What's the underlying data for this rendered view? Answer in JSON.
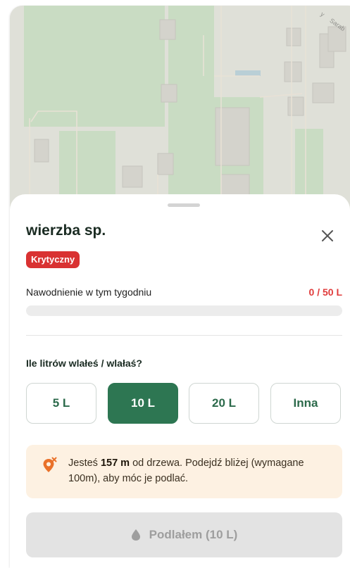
{
  "map": {
    "street_label": "Sarab",
    "street_label_prefix": "y"
  },
  "tree": {
    "name": "wierzba sp.",
    "status_badge": "Krytyczny"
  },
  "watering": {
    "label": "Nawodnienie w tym tygodniu",
    "value": "0 / 50 L",
    "progress_fraction": 0
  },
  "question": "Ile litrów wlałeś / wlałaś?",
  "volume_options": [
    {
      "label": "5 L",
      "selected": false
    },
    {
      "label": "10 L",
      "selected": true
    },
    {
      "label": "20 L",
      "selected": false
    },
    {
      "label": "Inna",
      "selected": false
    }
  ],
  "notice": {
    "prefix": "Jesteś",
    "distance": "157 m",
    "suffix": "od drzewa. Podejdź bliżej (wymagane 100m), aby móc je podlać."
  },
  "submit_label": "Podlałem (10 L)",
  "colors": {
    "accent": "#2d7652",
    "critical": "#d93232",
    "notice_bg": "#fdf1e2",
    "notice_icon": "#e9712a"
  },
  "icons": {
    "close": "close-icon",
    "location_warning": "location-off-icon",
    "drop": "water-drop-icon"
  }
}
